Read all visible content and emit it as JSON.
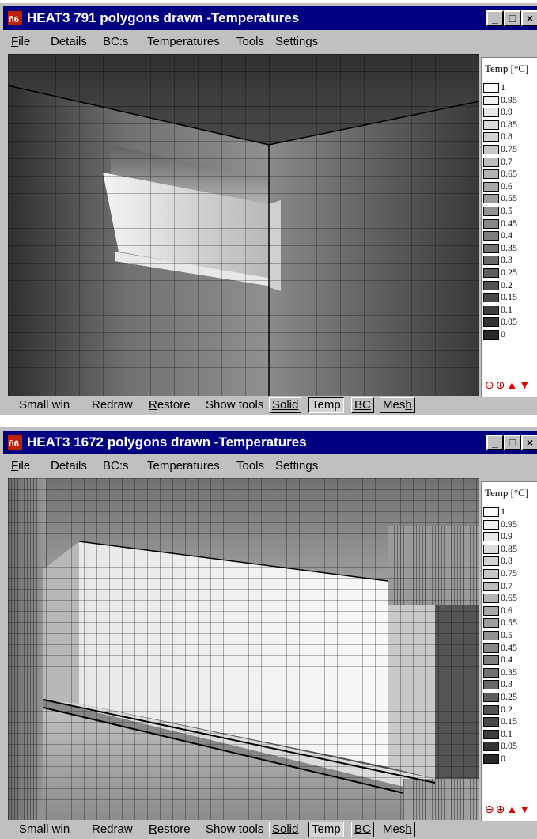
{
  "windows": [
    {
      "title": "HEAT3 791 polygons drawn -Temperatures",
      "legend_title": "Temp [°C]",
      "legend_values": [
        "1",
        "0.95",
        "0.9",
        "0.85",
        "0.8",
        "0.75",
        "0.7",
        "0.65",
        "0.6",
        "0.55",
        "0.5",
        "0.45",
        "0.4",
        "0.35",
        "0.3",
        "0.25",
        "0.2",
        "0.15",
        "0.1",
        "0.05",
        "0"
      ]
    },
    {
      "title": "HEAT3 1672 polygons drawn -Temperatures",
      "legend_title": "Temp [°C]",
      "legend_values": [
        "1",
        "0.95",
        "0.9",
        "0.85",
        "0.8",
        "0.75",
        "0.7",
        "0.65",
        "0.6",
        "0.55",
        "0.5",
        "0.45",
        "0.4",
        "0.35",
        "0.3",
        "0.25",
        "0.2",
        "0.15",
        "0.1",
        "0.05",
        "0"
      ]
    }
  ],
  "menu": [
    {
      "first": "F",
      "rest": "ile"
    },
    {
      "first": "",
      "rest": "Details"
    },
    {
      "first": "",
      "rest": "BC:s"
    },
    {
      "first": "",
      "rest": "Temperatures"
    },
    {
      "first": "",
      "rest": "Tools"
    },
    {
      "first": "",
      "rest": "Settings"
    }
  ],
  "bottom": {
    "small_win": "Small win",
    "redraw": "Redraw",
    "restore_first": "R",
    "restore_rest": "estore",
    "show_tools": "Show tools",
    "solid": "Solid",
    "temp": "Temp",
    "bc": "BC",
    "mesh_main": "Mes",
    "mesh_ul": "h"
  },
  "colors": {
    "titlebar": "#000080",
    "window_face": "#c0c0c0"
  },
  "icons": [
    "app-icon",
    "minimize-icon",
    "maximize-icon",
    "close-icon",
    "zoom-out-icon",
    "zoom-in-icon",
    "arrow-up-icon",
    "arrow-down-icon"
  ]
}
